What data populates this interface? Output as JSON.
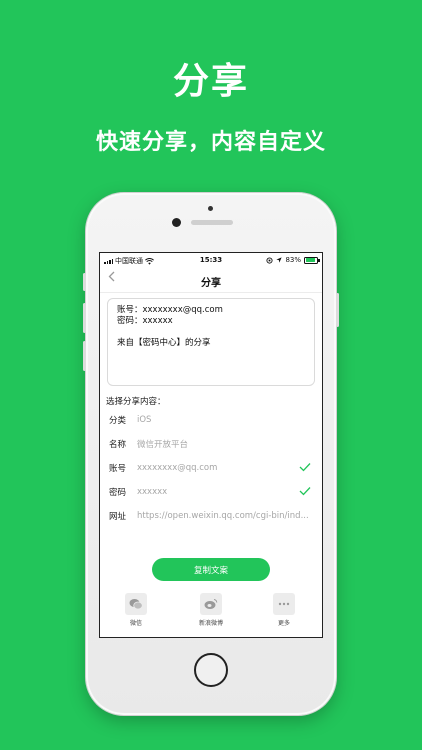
{
  "hero": {
    "title": "分享",
    "subtitle": "快速分享，内容自定义"
  },
  "status_bar": {
    "carrier": "中国联通",
    "time": "15:33",
    "battery": "83%",
    "battery_level": 0.83
  },
  "nav": {
    "back_icon": "chevron-left-icon",
    "title": "分享"
  },
  "preview": {
    "account_line": "账号：xxxxxxxx@qq.com",
    "password_line": "密码：xxxxxx",
    "source_line": "来自【密码中心】的分享"
  },
  "section_label": "选择分享内容：",
  "fields": [
    {
      "key": "分类",
      "value": "iOS",
      "checked": false
    },
    {
      "key": "名称",
      "value": "微信开放平台",
      "checked": false
    },
    {
      "key": "账号",
      "value": "xxxxxxxx@qq.com",
      "checked": true
    },
    {
      "key": "密码",
      "value": "xxxxxx",
      "checked": true
    },
    {
      "key": "网址",
      "value": "https://open.weixin.qq.com/cgi-bin/ind...",
      "checked": false
    }
  ],
  "copy_button": "复制文案",
  "share_targets": [
    {
      "label": "微信",
      "icon": "wechat-icon"
    },
    {
      "label": "新浪微博",
      "icon": "weibo-icon"
    },
    {
      "label": "更多",
      "icon": "more-icon"
    }
  ],
  "colors": {
    "accent": "#22c55a",
    "check": "#22c55a"
  }
}
